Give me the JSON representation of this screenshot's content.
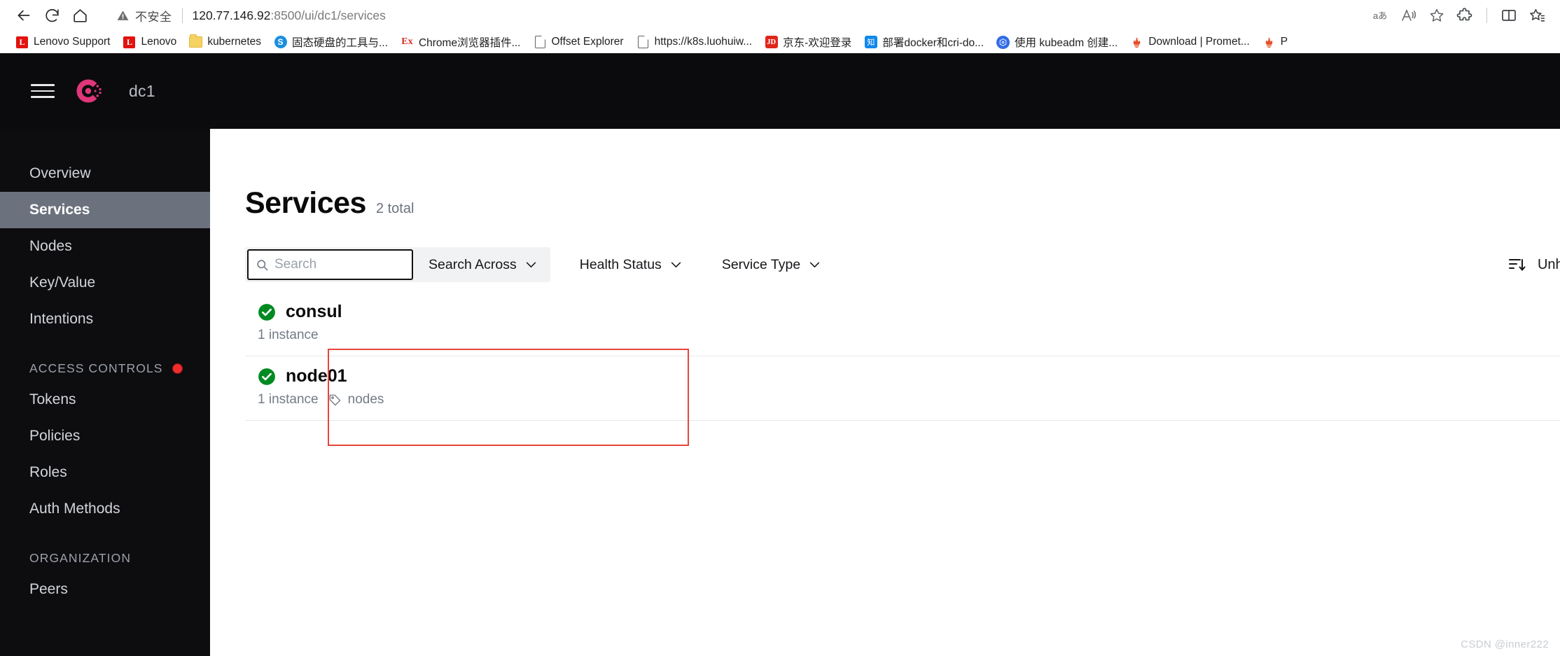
{
  "browser": {
    "nav": {
      "back_icon": "arrow-left-icon",
      "reload_icon": "reload-icon",
      "home_icon": "home-icon"
    },
    "omnibox": {
      "security_icon": "warning-triangle-icon",
      "security_label": "不安全",
      "url_host": "120.77.146.92",
      "url_path": ":8500/ui/dc1/services"
    },
    "toolbar_right": [
      {
        "name": "translate-icon",
        "glyph": "aあ"
      },
      {
        "name": "read-aloud-icon",
        "glyph": "A"
      },
      {
        "name": "favorite-star-icon",
        "glyph": "☆"
      },
      {
        "name": "extensions-icon",
        "glyph": "puzzle"
      },
      {
        "name": "split-screen-icon",
        "glyph": "split"
      },
      {
        "name": "collections-icon",
        "glyph": "star-list"
      }
    ],
    "bookmarks": [
      {
        "label": "Lenovo Support",
        "icon": "lenovo-icon"
      },
      {
        "label": "Lenovo",
        "icon": "lenovo-icon"
      },
      {
        "label": "kubernetes",
        "icon": "folder-icon"
      },
      {
        "label": "固态硬盘的工具与...",
        "icon": "sogou-s-icon"
      },
      {
        "label": "Chrome浏览器插件...",
        "icon": "extension-ex-icon"
      },
      {
        "label": "Offset Explorer",
        "icon": "document-icon"
      },
      {
        "label": "https://k8s.luohuiw...",
        "icon": "document-icon"
      },
      {
        "label": "京东-欢迎登录",
        "icon": "jd-icon"
      },
      {
        "label": "部署docker和cri-do...",
        "icon": "zhihu-icon"
      },
      {
        "label": "使用 kubeadm 创建...",
        "icon": "kubernetes-icon"
      },
      {
        "label": "Download | Promet...",
        "icon": "prometheus-icon"
      },
      {
        "label": "P",
        "icon": "prometheus-icon"
      }
    ]
  },
  "app": {
    "header": {
      "menu_icon": "hamburger-menu-icon",
      "logo_icon": "consul-logo-icon",
      "datacenter": "dc1"
    },
    "sidebar": {
      "items": [
        {
          "label": "Overview",
          "active": false
        },
        {
          "label": "Services",
          "active": true
        },
        {
          "label": "Nodes",
          "active": false
        },
        {
          "label": "Key/Value",
          "active": false
        },
        {
          "label": "Intentions",
          "active": false
        }
      ],
      "section_acl": {
        "label": "ACCESS CONTROLS",
        "badge_icon": "red-status-dot-icon",
        "items": [
          {
            "label": "Tokens"
          },
          {
            "label": "Policies"
          },
          {
            "label": "Roles"
          },
          {
            "label": "Auth Methods"
          }
        ]
      },
      "section_org": {
        "label": "ORGANIZATION",
        "items": [
          {
            "label": "Peers"
          }
        ]
      }
    },
    "main": {
      "title": "Services",
      "total_label": "2 total",
      "filters": {
        "search_icon": "search-icon",
        "search_value": "",
        "search_placeholder": "Search",
        "search_across_label": "Search Across",
        "health_status_label": "Health Status",
        "service_type_label": "Service Type",
        "sort_icon": "sort-descending-icon",
        "sort_label": "Unhealthy"
      },
      "services": [
        {
          "name": "consul",
          "health_icon": "health-check-passing-icon",
          "health_color": "#008a22",
          "instances": "1 instance",
          "tags": []
        },
        {
          "name": "node01",
          "health_icon": "health-check-passing-icon",
          "health_color": "#008a22",
          "instances": "1 instance",
          "tags": [
            "nodes"
          ],
          "tag_icon": "tag-icon"
        }
      ]
    }
  },
  "watermark": "CSDN @inner222"
}
